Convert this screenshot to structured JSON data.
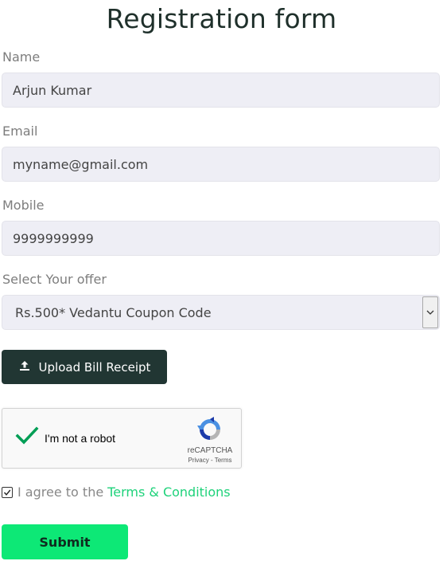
{
  "form": {
    "title": "Registration form",
    "name": {
      "label": "Name",
      "value": "Arjun Kumar"
    },
    "email": {
      "label": "Email",
      "value": "myname@gmail.com"
    },
    "mobile": {
      "label": "Mobile",
      "value": "9999999999"
    },
    "offer": {
      "label": "Select Your offer",
      "selected": "Rs.500* Vedantu Coupon Code"
    },
    "upload": {
      "label": "Upload Bill Receipt",
      "icon": "upload-icon"
    },
    "recaptcha": {
      "label": "I'm not a robot",
      "brand": "reCAPTCHA",
      "privacy": "Privacy",
      "separator": " - ",
      "terms": "Terms",
      "checked": true
    },
    "agree": {
      "text": "I agree to the",
      "link": "Terms & Conditions",
      "checked": true
    },
    "submit": "Submit"
  },
  "colors": {
    "title": "#1f302b",
    "field_bg": "#eeeef5",
    "upload_btn": "#213633",
    "submit_btn": "#0de876",
    "link": "#1ed27a",
    "check_green": "#009e55"
  }
}
